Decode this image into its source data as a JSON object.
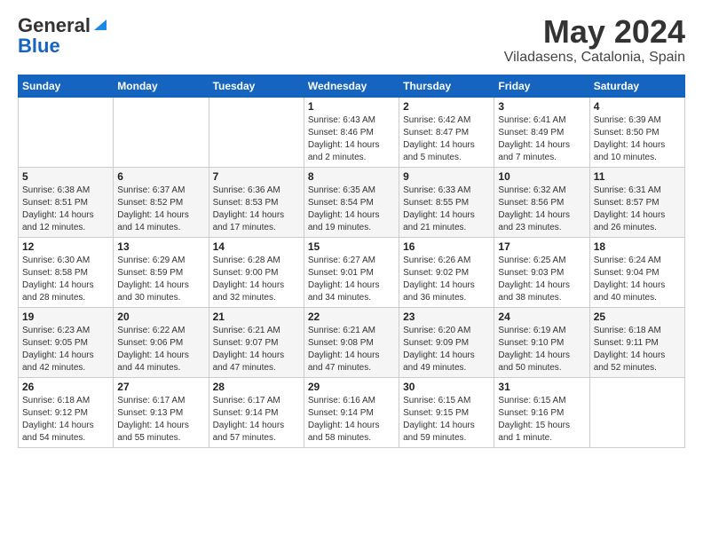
{
  "header": {
    "logo_line1": "General",
    "logo_line2": "Blue",
    "month": "May 2024",
    "location": "Viladasens, Catalonia, Spain"
  },
  "weekdays": [
    "Sunday",
    "Monday",
    "Tuesday",
    "Wednesday",
    "Thursday",
    "Friday",
    "Saturday"
  ],
  "weeks": [
    [
      {
        "day": "",
        "info": ""
      },
      {
        "day": "",
        "info": ""
      },
      {
        "day": "",
        "info": ""
      },
      {
        "day": "1",
        "info": "Sunrise: 6:43 AM\nSunset: 8:46 PM\nDaylight: 14 hours\nand 2 minutes."
      },
      {
        "day": "2",
        "info": "Sunrise: 6:42 AM\nSunset: 8:47 PM\nDaylight: 14 hours\nand 5 minutes."
      },
      {
        "day": "3",
        "info": "Sunrise: 6:41 AM\nSunset: 8:49 PM\nDaylight: 14 hours\nand 7 minutes."
      },
      {
        "day": "4",
        "info": "Sunrise: 6:39 AM\nSunset: 8:50 PM\nDaylight: 14 hours\nand 10 minutes."
      }
    ],
    [
      {
        "day": "5",
        "info": "Sunrise: 6:38 AM\nSunset: 8:51 PM\nDaylight: 14 hours\nand 12 minutes."
      },
      {
        "day": "6",
        "info": "Sunrise: 6:37 AM\nSunset: 8:52 PM\nDaylight: 14 hours\nand 14 minutes."
      },
      {
        "day": "7",
        "info": "Sunrise: 6:36 AM\nSunset: 8:53 PM\nDaylight: 14 hours\nand 17 minutes."
      },
      {
        "day": "8",
        "info": "Sunrise: 6:35 AM\nSunset: 8:54 PM\nDaylight: 14 hours\nand 19 minutes."
      },
      {
        "day": "9",
        "info": "Sunrise: 6:33 AM\nSunset: 8:55 PM\nDaylight: 14 hours\nand 21 minutes."
      },
      {
        "day": "10",
        "info": "Sunrise: 6:32 AM\nSunset: 8:56 PM\nDaylight: 14 hours\nand 23 minutes."
      },
      {
        "day": "11",
        "info": "Sunrise: 6:31 AM\nSunset: 8:57 PM\nDaylight: 14 hours\nand 26 minutes."
      }
    ],
    [
      {
        "day": "12",
        "info": "Sunrise: 6:30 AM\nSunset: 8:58 PM\nDaylight: 14 hours\nand 28 minutes."
      },
      {
        "day": "13",
        "info": "Sunrise: 6:29 AM\nSunset: 8:59 PM\nDaylight: 14 hours\nand 30 minutes."
      },
      {
        "day": "14",
        "info": "Sunrise: 6:28 AM\nSunset: 9:00 PM\nDaylight: 14 hours\nand 32 minutes."
      },
      {
        "day": "15",
        "info": "Sunrise: 6:27 AM\nSunset: 9:01 PM\nDaylight: 14 hours\nand 34 minutes."
      },
      {
        "day": "16",
        "info": "Sunrise: 6:26 AM\nSunset: 9:02 PM\nDaylight: 14 hours\nand 36 minutes."
      },
      {
        "day": "17",
        "info": "Sunrise: 6:25 AM\nSunset: 9:03 PM\nDaylight: 14 hours\nand 38 minutes."
      },
      {
        "day": "18",
        "info": "Sunrise: 6:24 AM\nSunset: 9:04 PM\nDaylight: 14 hours\nand 40 minutes."
      }
    ],
    [
      {
        "day": "19",
        "info": "Sunrise: 6:23 AM\nSunset: 9:05 PM\nDaylight: 14 hours\nand 42 minutes."
      },
      {
        "day": "20",
        "info": "Sunrise: 6:22 AM\nSunset: 9:06 PM\nDaylight: 14 hours\nand 44 minutes."
      },
      {
        "day": "21",
        "info": "Sunrise: 6:21 AM\nSunset: 9:07 PM\nDaylight: 14 hours\nand 47 minutes."
      },
      {
        "day": "22",
        "info": "Sunrise: 6:21 AM\nSunset: 9:08 PM\nDaylight: 14 hours\nand 47 minutes."
      },
      {
        "day": "23",
        "info": "Sunrise: 6:20 AM\nSunset: 9:09 PM\nDaylight: 14 hours\nand 49 minutes."
      },
      {
        "day": "24",
        "info": "Sunrise: 6:19 AM\nSunset: 9:10 PM\nDaylight: 14 hours\nand 50 minutes."
      },
      {
        "day": "25",
        "info": "Sunrise: 6:18 AM\nSunset: 9:11 PM\nDaylight: 14 hours\nand 52 minutes."
      }
    ],
    [
      {
        "day": "26",
        "info": "Sunrise: 6:18 AM\nSunset: 9:12 PM\nDaylight: 14 hours\nand 54 minutes."
      },
      {
        "day": "27",
        "info": "Sunrise: 6:17 AM\nSunset: 9:13 PM\nDaylight: 14 hours\nand 55 minutes."
      },
      {
        "day": "28",
        "info": "Sunrise: 6:17 AM\nSunset: 9:14 PM\nDaylight: 14 hours\nand 57 minutes."
      },
      {
        "day": "29",
        "info": "Sunrise: 6:16 AM\nSunset: 9:14 PM\nDaylight: 14 hours\nand 58 minutes."
      },
      {
        "day": "30",
        "info": "Sunrise: 6:15 AM\nSunset: 9:15 PM\nDaylight: 14 hours\nand 59 minutes."
      },
      {
        "day": "31",
        "info": "Sunrise: 6:15 AM\nSunset: 9:16 PM\nDaylight: 15 hours\nand 1 minute."
      },
      {
        "day": "",
        "info": ""
      }
    ]
  ]
}
